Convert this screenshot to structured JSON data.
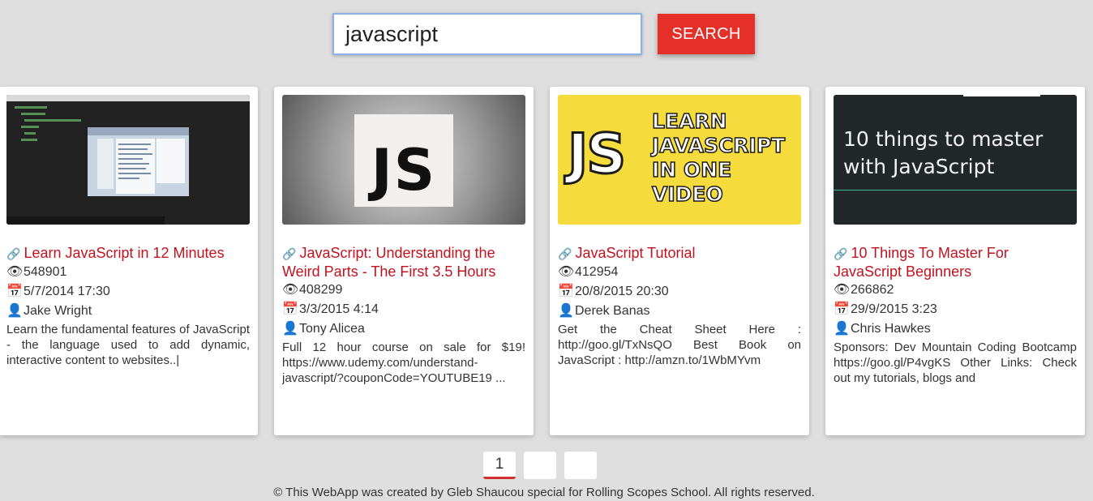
{
  "search": {
    "value": "javascript",
    "button_label": "SEARCH"
  },
  "cards": [
    {
      "title": "Learn JavaScript in 12 Minutes",
      "views": "548901",
      "date": "5/7/2014 17:30",
      "author": "Jake Wright",
      "description": "Learn the fundamental features of JavaScript - the language used to add dynamic, interactive content to websites..|"
    },
    {
      "title": "JavaScript: Understanding the Weird Parts - The First 3.5 Hours",
      "views": "408299",
      "date": "3/3/2015 4:14",
      "author": "Tony Alicea",
      "description": "Full 12 hour course on sale for $19! https://www.udemy.com/understand-javascript/?couponCode=YOUTUBE19 ..."
    },
    {
      "title": "JavaScript Tutorial",
      "views": "412954",
      "date": "20/8/2015 20:30",
      "author": "Derek Banas",
      "description": "Get the Cheat Sheet Here : http://goo.gl/TxNsQO Best Book on JavaScript : http://amzn.to/1WbMYvm"
    },
    {
      "title": "10 Things To Master For JavaScript Beginners",
      "views": "266862",
      "date": "29/9/2015 3:23",
      "author": "Chris Hawkes",
      "description": "Sponsors: Dev Mountain Coding Bootcamp https://goo.gl/P4vgKS Other Links: Check out my tutorials, blogs and"
    }
  ],
  "thumbnails": {
    "js_logo": "JS",
    "learn_js_lines": [
      "LEARN",
      "JAVASCRIPT",
      "IN ONE",
      "VIDEO"
    ],
    "ten_things_lines": [
      "10 things to master",
      "with JavaScript"
    ]
  },
  "pagination": {
    "pages": [
      "1",
      "",
      ""
    ]
  },
  "footer": {
    "text": "© This WebApp was created by Gleb Shaucou special for Rolling Scopes School. All rights reserved."
  },
  "colors": {
    "accent_red": "#e5302a",
    "title_red": "#c1121f",
    "background": "#dedede",
    "yellow_thumb": "#f5dc3c"
  },
  "icons": [
    "link-icon",
    "eye-icon",
    "calendar-icon",
    "user-icon"
  ]
}
